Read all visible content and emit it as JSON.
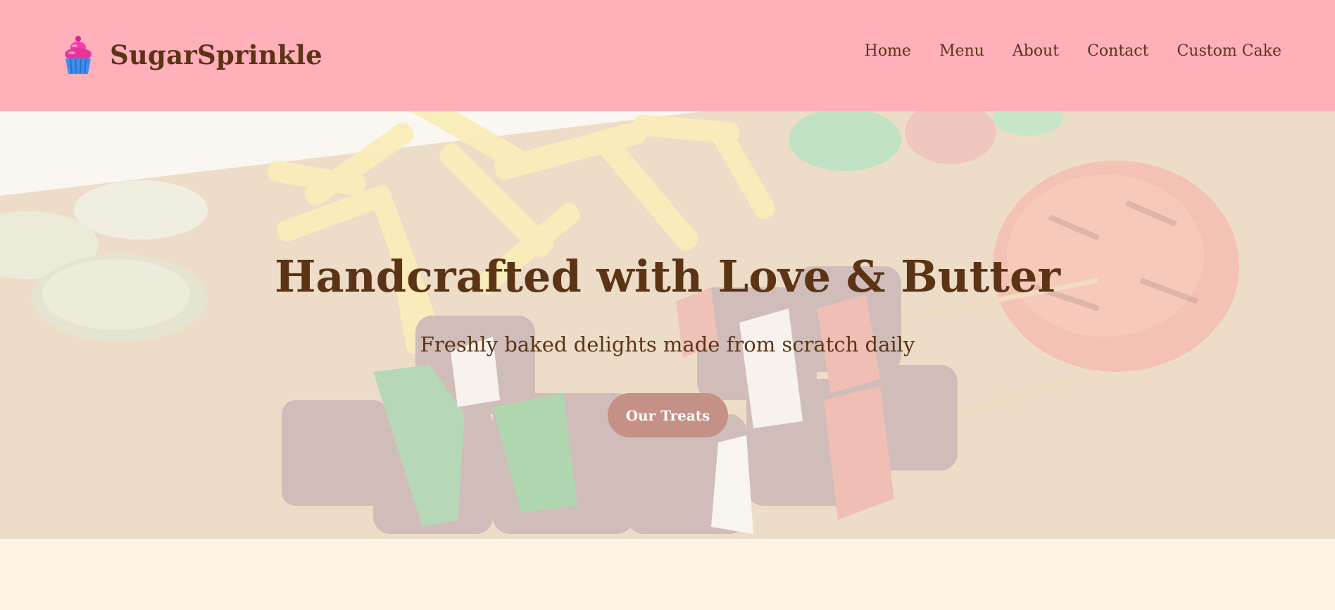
{
  "brand": {
    "name": "SugarSprinkle",
    "icon": "cupcake-icon"
  },
  "nav": {
    "items": [
      {
        "label": "Home"
      },
      {
        "label": "Menu"
      },
      {
        "label": "About"
      },
      {
        "label": "Contact"
      },
      {
        "label": "Custom Cake"
      }
    ]
  },
  "hero": {
    "title": "Handcrafted with Love & Butter",
    "subtitle": "Freshly baked delights made from scratch daily",
    "button_label": "Our Treats",
    "background_image": "faded photo of grilled beef kebabs with peppers, onions, tomato, french fries and pickles on a wooden board"
  },
  "colors": {
    "header_bg": "#ffb0bb",
    "text_brown": "#5b3416",
    "button_bg": "#c59085",
    "page_bg": "#fff3e3"
  }
}
